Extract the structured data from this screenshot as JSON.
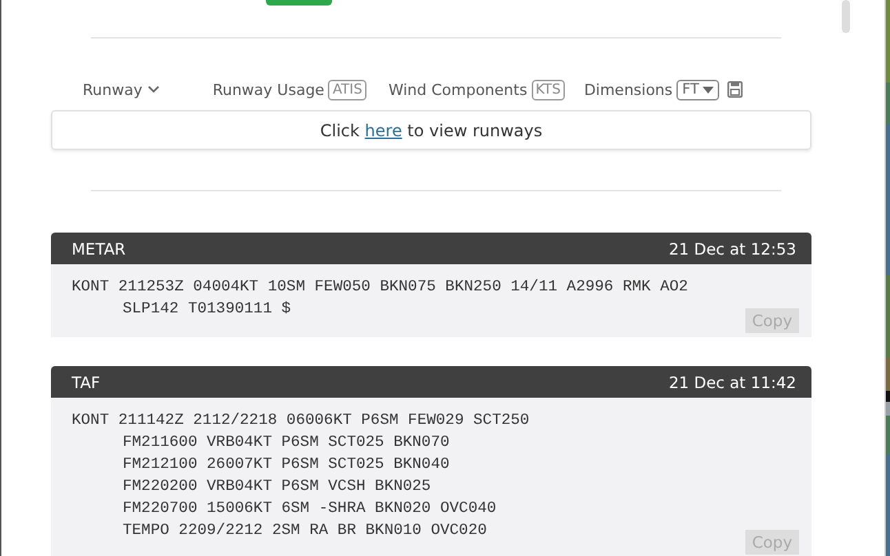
{
  "toolbar": [
    {
      "kind": "dropdown",
      "label": "Runway"
    },
    {
      "kind": "tag",
      "label": "Runway Usage",
      "tag": "ATIS"
    },
    {
      "kind": "tag",
      "label": "Wind Components",
      "tag": "KTS"
    },
    {
      "kind": "select",
      "label": "Dimensions",
      "value": "FT"
    }
  ],
  "runway_box": {
    "before": "Click",
    "link": "here",
    "after": "to view runways"
  },
  "reports": [
    {
      "title": "METAR",
      "time": "21 Dec at 12:53",
      "lines": [
        "KONT 211253Z 04004KT 10SM FEW050 BKN075 BKN250 14/11 A2996 RMK AO2",
        "SLP142 T01390111 $"
      ],
      "button": "Copy"
    },
    {
      "title": "TAF",
      "time": "21 Dec at 11:42",
      "lines": [
        "KONT 211142Z 2112/2218 06006KT P6SM FEW029 SCT250",
        "FM211600 VRB04KT P6SM SCT025 BKN070",
        "FM212100 26007KT P6SM SCT025 BKN040",
        "FM220200 VRB04KT P6SM VCSH BKN025",
        "FM220700 15006KT 6SM -SHRA BKN020 OVC040",
        "TEMPO 2209/2212 2SM RA BR BKN010 OVC020"
      ],
      "button": "Copy"
    }
  ]
}
